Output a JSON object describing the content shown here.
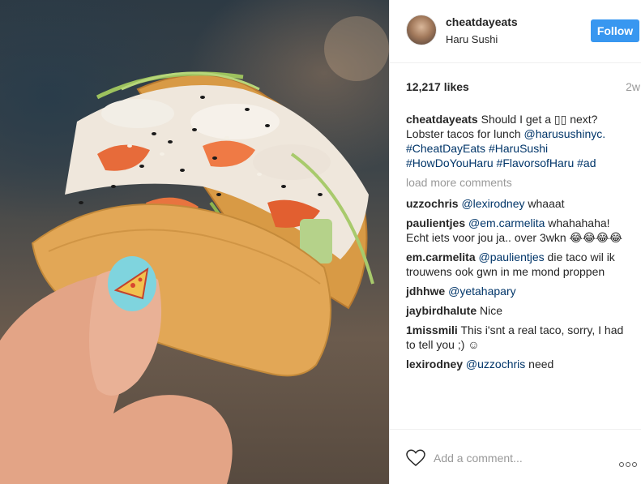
{
  "post": {
    "username": "cheatdayeats",
    "location": "Haru Sushi",
    "follow_label": "Follow",
    "likes": "12,217 likes",
    "age": "2w",
    "caption": {
      "username": "cheatdayeats",
      "text_1": "Should I get a ",
      "text_2": " next? Lobster tacos for lunch ",
      "mention": "@harusushinyc.",
      "hashtags": "#CheatDayEats #HaruSushi #HowDoYouHaru #FlavorsofHaru #ad"
    },
    "load_more": "load more comments",
    "comments": [
      {
        "user": "uzzochris",
        "mention": "@lexirodney",
        "text": " whaaat"
      },
      {
        "user": "paulientjes",
        "mention": "@em.carmelita",
        "text": " whahahaha! Echt iets voor jou ja.. over 3wkn 😂😂😂😂"
      },
      {
        "user": "em.carmelita",
        "mention": "@paulientjes",
        "text": " die taco wil ik trouwens ook gwn in me mond proppen"
      },
      {
        "user": "jdhhwe",
        "mention": "@yetahapary",
        "text": ""
      },
      {
        "user": "jaybirdhalute",
        "mention": "",
        "text": " Nice"
      },
      {
        "user": "1missmili",
        "mention": "",
        "text": " This i'snt a real taco, sorry, I had to tell you ;) ☺"
      },
      {
        "user": "lexirodney",
        "mention": "@uzzochris",
        "text": " need"
      }
    ],
    "add_comment_placeholder": "Add a comment..."
  },
  "colors": {
    "accent": "#3897f0",
    "link": "#003569",
    "muted": "#999999"
  },
  "icons": [
    "heart-icon",
    "more-options-icon",
    "pizza-nail-art"
  ]
}
